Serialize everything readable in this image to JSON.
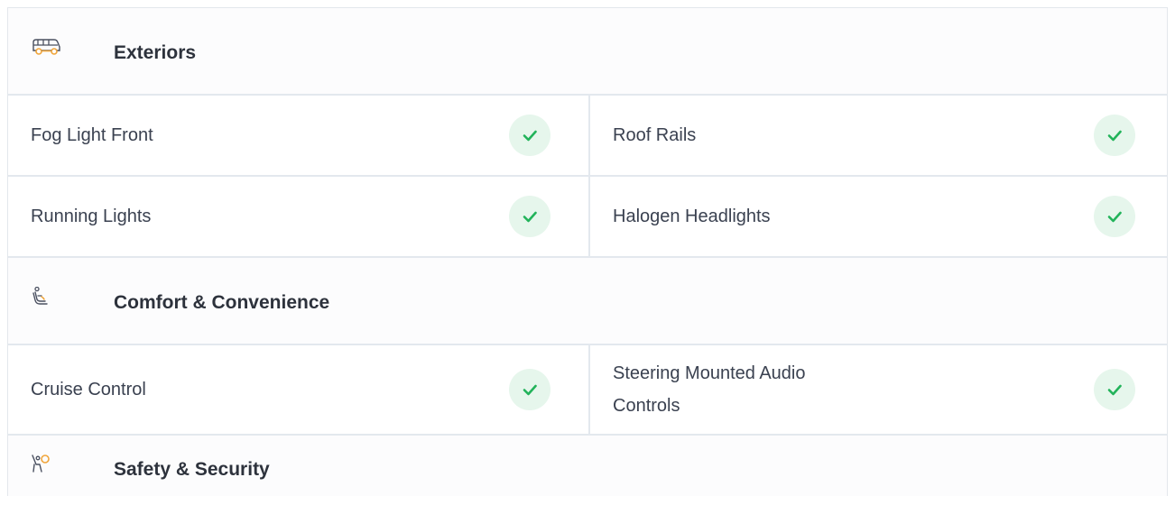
{
  "sections": {
    "exteriors": {
      "title": "Exteriors",
      "icon": "car-icon",
      "rows": [
        {
          "left": "Fog Light Front",
          "right": "Roof Rails"
        },
        {
          "left": "Running Lights",
          "right": "Halogen Headlights"
        }
      ]
    },
    "comfort": {
      "title": "Comfort & Convenience",
      "icon": "seat-icon",
      "rows": [
        {
          "left": "Cruise Control",
          "right": "Steering Mounted Audio Controls"
        }
      ]
    },
    "safety": {
      "title": "Safety & Security",
      "icon": "airbag-icon"
    }
  },
  "colors": {
    "check": "#22b35a",
    "check_bg": "#e6f6ec",
    "icon_accent": "#f0a53a",
    "border": "#e3e8ee"
  }
}
